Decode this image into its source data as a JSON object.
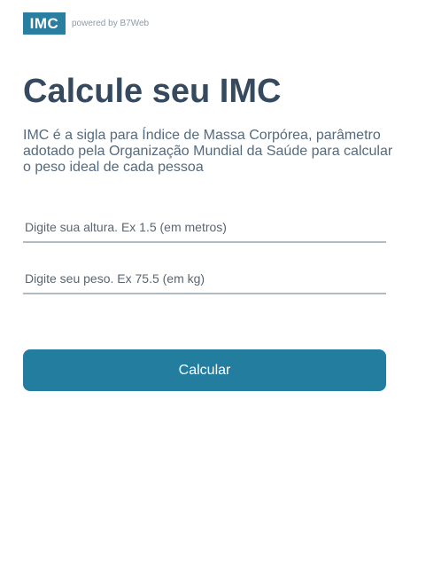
{
  "header": {
    "logo_text": "IMC",
    "powered_text": "powered by B7Web"
  },
  "main": {
    "title": "Calcule seu IMC",
    "description": "IMC é a sigla para Índice de Massa Corpórea, parâmetro adotado pela Organização Mundial da Saúde para calcular o peso ideal de cada pessoa",
    "altura_placeholder": "Digite sua altura. Ex 1.5 (em metros)",
    "altura_value": "",
    "peso_placeholder": "Digite seu peso. Ex 75.5 (em kg)",
    "peso_value": "",
    "calculate_label": "Calcular"
  },
  "colors": {
    "brand": "#2a7ea0",
    "button": "#227d9f",
    "title": "#354a5f"
  }
}
